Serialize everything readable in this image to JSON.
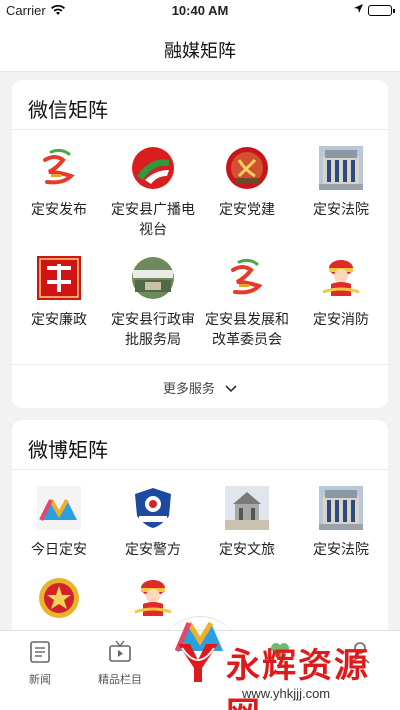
{
  "status_bar": {
    "carrier": "Carrier",
    "time": "10:40 AM"
  },
  "nav": {
    "title": "融媒矩阵"
  },
  "wechat": {
    "title": "微信矩阵",
    "items": [
      {
        "label": "定安发布",
        "icon": "dingan-logo-icon"
      },
      {
        "label": "定安县广播电视台",
        "icon": "tv-station-logo-icon"
      },
      {
        "label": "定安党建",
        "icon": "party-emblem-icon"
      },
      {
        "label": "定安法院",
        "icon": "court-building-icon"
      },
      {
        "label": "定安廉政",
        "icon": "anti-corruption-logo-icon"
      },
      {
        "label": "定安县行政审批服务局",
        "icon": "admin-approval-logo-icon"
      },
      {
        "label": "定安县发展和改革委员会",
        "icon": "dingan-logo-icon"
      },
      {
        "label": "定安消防",
        "icon": "firefighter-mascot-icon"
      }
    ],
    "more_label": "更多服务"
  },
  "weibo": {
    "title": "微博矩阵",
    "items": [
      {
        "label": "今日定安",
        "icon": "today-dingan-logo-icon"
      },
      {
        "label": "定安警方",
        "icon": "police-badge-icon"
      },
      {
        "label": "定安文旅",
        "icon": "tourism-photo-icon"
      },
      {
        "label": "定安法院",
        "icon": "court-building-icon"
      },
      {
        "label": "",
        "icon": "youth-league-emblem-icon"
      },
      {
        "label": "",
        "icon": "firefighter-mascot-icon"
      }
    ]
  },
  "tabs": [
    {
      "label": "新闻",
      "icon": "news-icon"
    },
    {
      "label": "精品栏目",
      "icon": "tv-program-icon"
    },
    {
      "label": "",
      "icon": "center-logo-icon"
    },
    {
      "label": "",
      "icon": "service-icon"
    },
    {
      "label": "",
      "icon": "profile-icon"
    }
  ],
  "watermark": {
    "text": "永辉资源网",
    "url": "www.yhkjjj.com"
  },
  "colors": {
    "accent_red": "#e01a1a",
    "background": "#f2f2f2",
    "card": "#ffffff"
  }
}
